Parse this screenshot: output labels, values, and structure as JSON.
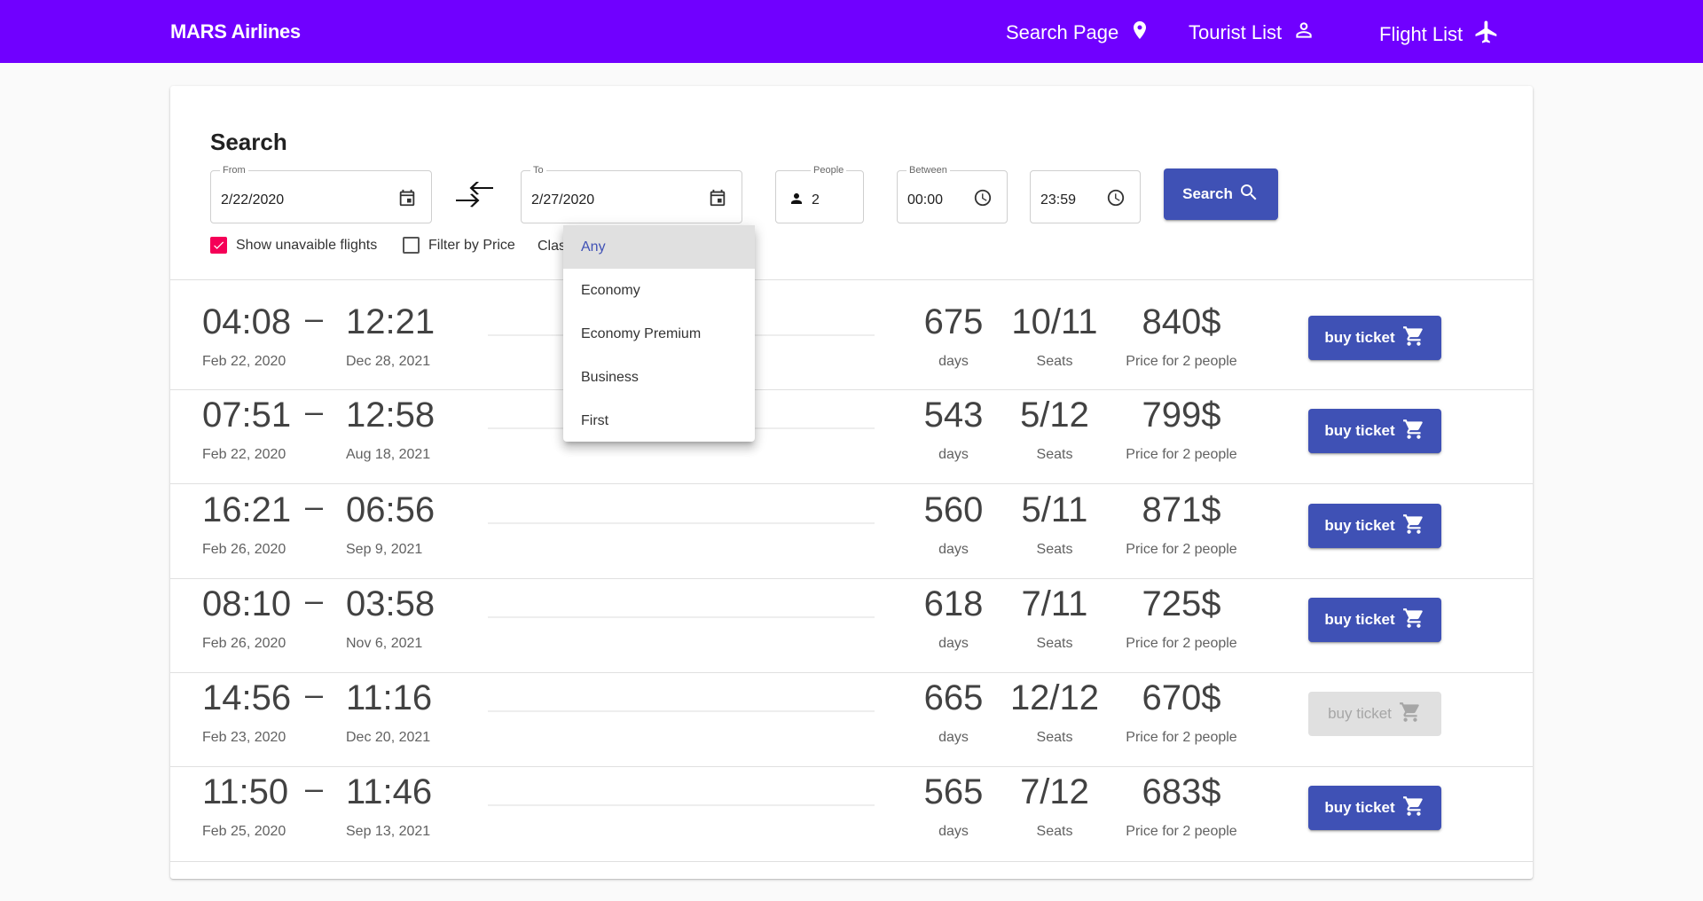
{
  "header": {
    "brand": "MARS Airlines",
    "nav": [
      {
        "label": "Search Page",
        "icon": "location-pin-icon"
      },
      {
        "label": "Tourist List",
        "icon": "person-icon"
      },
      {
        "label": "Flight List",
        "icon": "airplane-icon"
      }
    ],
    "bg_color": "#7000ff"
  },
  "search": {
    "title": "Search",
    "from": {
      "label": "From",
      "value": "2/22/2020"
    },
    "to": {
      "label": "To",
      "value": "2/27/2020"
    },
    "people": {
      "label": "People",
      "value": "2"
    },
    "between": {
      "label": "Between",
      "start": "00:00",
      "end": "23:59"
    },
    "button_label": "Search",
    "show_unavailable": {
      "label": "Show unavaible flights",
      "checked": true
    },
    "filter_price": {
      "label": "Filter by Price",
      "checked": false
    },
    "class_label": "Class"
  },
  "class_menu": {
    "options": [
      "Any",
      "Economy",
      "Economy Premium",
      "Business",
      "First"
    ],
    "selected": "Any"
  },
  "flights": [
    {
      "dep_time": "04:08",
      "dep_date": "Feb 22, 2020",
      "arr_time": "12:21",
      "arr_date": "Dec 28, 2021",
      "days": "675",
      "days_label": "days",
      "seats": "10/11",
      "seats_label": "Seats",
      "price": "840$",
      "price_label": "Price for 2 people",
      "buy_label": "buy ticket",
      "available": true
    },
    {
      "dep_time": "07:51",
      "dep_date": "Feb 22, 2020",
      "arr_time": "12:58",
      "arr_date": "Aug 18, 2021",
      "days": "543",
      "days_label": "days",
      "seats": "5/12",
      "seats_label": "Seats",
      "price": "799$",
      "price_label": "Price for 2 people",
      "buy_label": "buy ticket",
      "available": true
    },
    {
      "dep_time": "16:21",
      "dep_date": "Feb 26, 2020",
      "arr_time": "06:56",
      "arr_date": "Sep 9, 2021",
      "days": "560",
      "days_label": "days",
      "seats": "5/11",
      "seats_label": "Seats",
      "price": "871$",
      "price_label": "Price for 2 people",
      "buy_label": "buy ticket",
      "available": true
    },
    {
      "dep_time": "08:10",
      "dep_date": "Feb 26, 2020",
      "arr_time": "03:58",
      "arr_date": "Nov 6, 2021",
      "days": "618",
      "days_label": "days",
      "seats": "7/11",
      "seats_label": "Seats",
      "price": "725$",
      "price_label": "Price for 2 people",
      "buy_label": "buy ticket",
      "available": true
    },
    {
      "dep_time": "14:56",
      "dep_date": "Feb 23, 2020",
      "arr_time": "11:16",
      "arr_date": "Dec 20, 2021",
      "days": "665",
      "days_label": "days",
      "seats": "12/12",
      "seats_label": "Seats",
      "price": "670$",
      "price_label": "Price for 2 people",
      "buy_label": "buy ticket",
      "available": false
    },
    {
      "dep_time": "11:50",
      "dep_date": "Feb 25, 2020",
      "arr_time": "11:46",
      "arr_date": "Sep 13, 2021",
      "days": "565",
      "days_label": "days",
      "seats": "7/12",
      "seats_label": "Seats",
      "price": "683$",
      "price_label": "Price for 2 people",
      "buy_label": "buy ticket",
      "available": true
    }
  ],
  "colors": {
    "primary": "#3f51b5",
    "checkbox": "#f50057"
  }
}
